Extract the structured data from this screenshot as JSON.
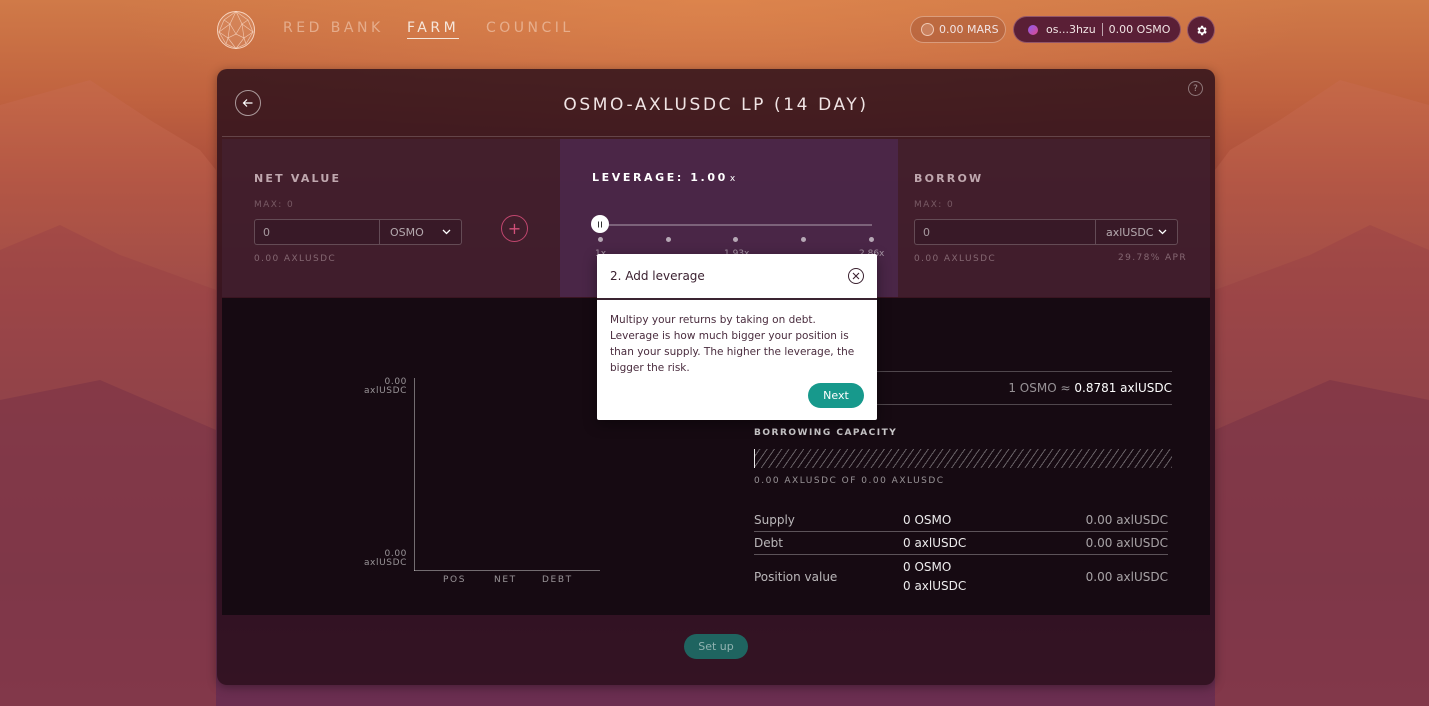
{
  "nav": {
    "logo_icon": "mars-globe-icon",
    "links": [
      "RED BANK",
      "FARM",
      "COUNCIL"
    ],
    "active": "FARM",
    "mars_balance": "0.00 MARS",
    "wallet_address": "os...3hzu",
    "wallet_balance": "0.00 OSMO",
    "settings_icon": "gear-icon"
  },
  "card": {
    "title": "OSMO-AXLUSDC LP (14 DAY)",
    "help_label": "?",
    "net_value": {
      "label": "NET VALUE",
      "max": "MAX: 0",
      "value": "0",
      "asset": "OSMO",
      "subtext": "0.00 AXLUSDC"
    },
    "leverage": {
      "label": "LEVERAGE: 1.00",
      "suffix": "x",
      "level": 1.0,
      "ticks": [
        "1x",
        "1.93x",
        "2.86x"
      ]
    },
    "borrow": {
      "label": "BORROW",
      "max": "MAX: 0",
      "value": "0",
      "asset": "axlUSDC",
      "subtext": "0.00 AXLUSDC",
      "apr": "29.78% APR"
    },
    "chart": {
      "y_top_value": "0.00",
      "y_top_unit": "axlUSDC",
      "y_bottom_value": "0.00",
      "y_bottom_unit": "axlUSDC",
      "categories": [
        "POS",
        "NET",
        "DEBT"
      ]
    },
    "rate": {
      "prefix": "1 OSMO ≈",
      "value": "0.8781 axlUSDC"
    },
    "capacity": {
      "label": "BORROWING CAPACITY",
      "fraction": 0,
      "text": "0.00 AXLUSDC OF 0.00 AXLUSDC"
    },
    "summary": {
      "supply": {
        "label": "Supply",
        "amount": "0 OSMO",
        "value": "0.00 axlUSDC"
      },
      "debt": {
        "label": "Debt",
        "amount": "0 axlUSDC",
        "value": "0.00 axlUSDC"
      },
      "position": {
        "label": "Position value",
        "amount1": "0 OSMO",
        "amount2": "0 axlUSDC",
        "value": "0.00 axlUSDC"
      }
    },
    "setup_label": "Set up"
  },
  "modal": {
    "title": "2. Add leverage",
    "body": "Multipy your returns by taking on debt. Leverage is how much bigger your position is than your supply. The higher the leverage, the bigger the risk.",
    "next_label": "Next"
  }
}
